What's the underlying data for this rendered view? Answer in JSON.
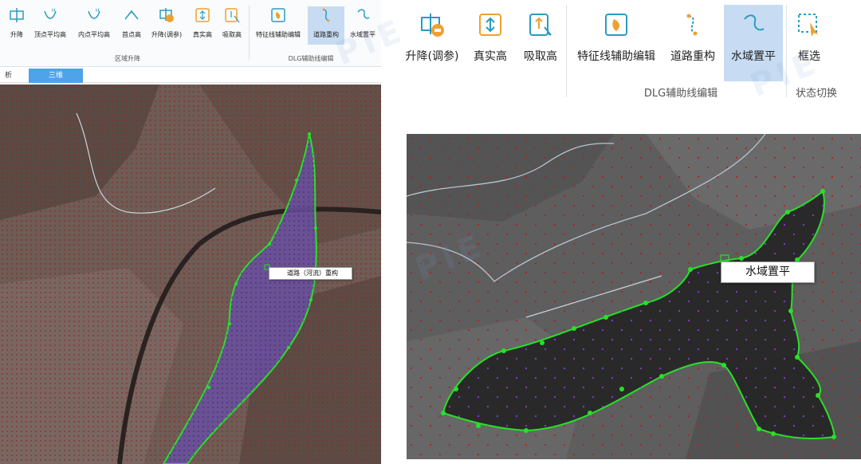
{
  "left_panel": {
    "ribbon": {
      "buttons": [
        {
          "label": "升降",
          "icon": "raise-lower-icon"
        },
        {
          "label": "顶点平均高",
          "icon": "vertex-average-height-icon"
        },
        {
          "label": "内点平均高",
          "icon": "interior-average-height-icon"
        },
        {
          "label": "首点高",
          "icon": "first-point-height-icon"
        },
        {
          "label": "升降(调参)",
          "icon": "raise-lower-adjust-icon"
        },
        {
          "label": "真实高",
          "icon": "true-height-icon"
        },
        {
          "label": "吸取高",
          "icon": "pick-height-icon"
        },
        {
          "label": "特征线辅助编辑",
          "icon": "feature-line-edit-icon"
        },
        {
          "label": "道路重构",
          "icon": "road-reconstruct-icon"
        },
        {
          "label": "水域置平",
          "icon": "water-flatten-icon"
        }
      ],
      "group_labels": [
        "区域升降",
        "DLG辅助线编辑"
      ]
    },
    "tabs": [
      "析",
      "三维"
    ],
    "active_tab": "三维",
    "popup_label": "道路（河流）重构"
  },
  "right_panel": {
    "ribbon": {
      "buttons": [
        {
          "label": "升降(调参)",
          "icon": "raise-lower-adjust-icon"
        },
        {
          "label": "真实高",
          "icon": "true-height-icon"
        },
        {
          "label": "吸取高",
          "icon": "pick-height-icon"
        },
        {
          "label": "特征线辅助编辑",
          "icon": "feature-line-edit-icon"
        },
        {
          "label": "道路重构",
          "icon": "road-reconstruct-icon"
        },
        {
          "label": "水域置平",
          "icon": "water-flatten-icon",
          "active": true
        },
        {
          "label": "框选",
          "icon": "box-select-icon"
        }
      ],
      "group_labels": [
        "DLG辅助线编辑",
        "状态切换"
      ]
    },
    "popup_label": "水域置平"
  },
  "colors": {
    "accent": "#4ea3ea",
    "active_button": "#c7dcf2",
    "icon_orange": "#f0a030",
    "icon_teal": "#2a9cc0",
    "polygon_stroke": "#28e028",
    "polygon_fill_left": "#6a4fa0",
    "polygon_fill_right": "#2a2a2a"
  }
}
